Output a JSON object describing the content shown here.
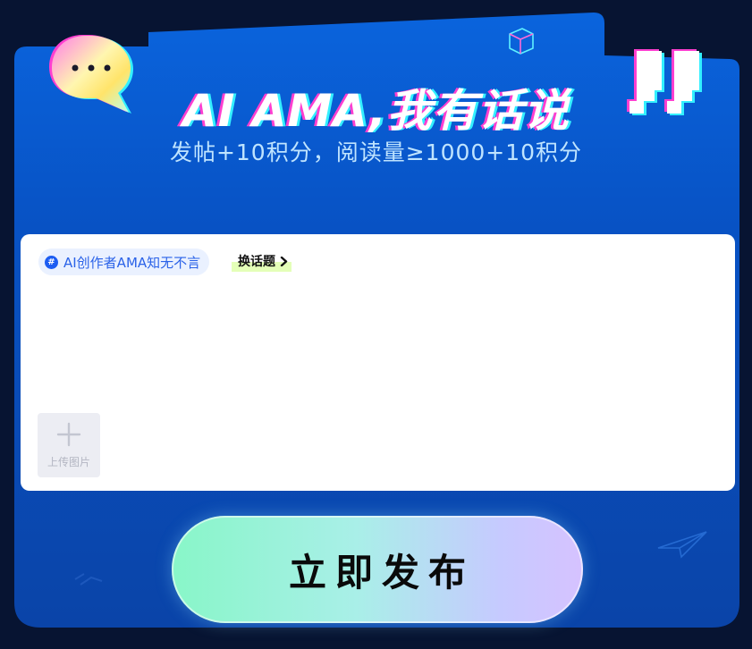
{
  "banner": {
    "title": "AI AMA,我有话说",
    "subtitle": "发帖+10积分，阅读量≥1000+10积分"
  },
  "editor": {
    "topic_label": "AI创作者AMA知无不言",
    "switch_topic_label": "换话题",
    "upload_label": "上传图片"
  },
  "actions": {
    "submit_label": "立即发布"
  },
  "colors": {
    "page_background": "#071432",
    "panel_top": "#0a5fd6",
    "panel_bottom": "#0a3fa6",
    "topic_accent": "#2a62e8",
    "button_gradient_start": "#88f6c8",
    "button_gradient_end": "#d6c2ff"
  },
  "icons": {
    "bubble": "speech-bubble-icon",
    "quotes": "pixel-quote-icon",
    "cube": "cube-icon",
    "plane": "paper-plane-icon",
    "hash": "hashtag-icon",
    "chevron": "chevron-right-icon",
    "plus": "plus-icon"
  }
}
